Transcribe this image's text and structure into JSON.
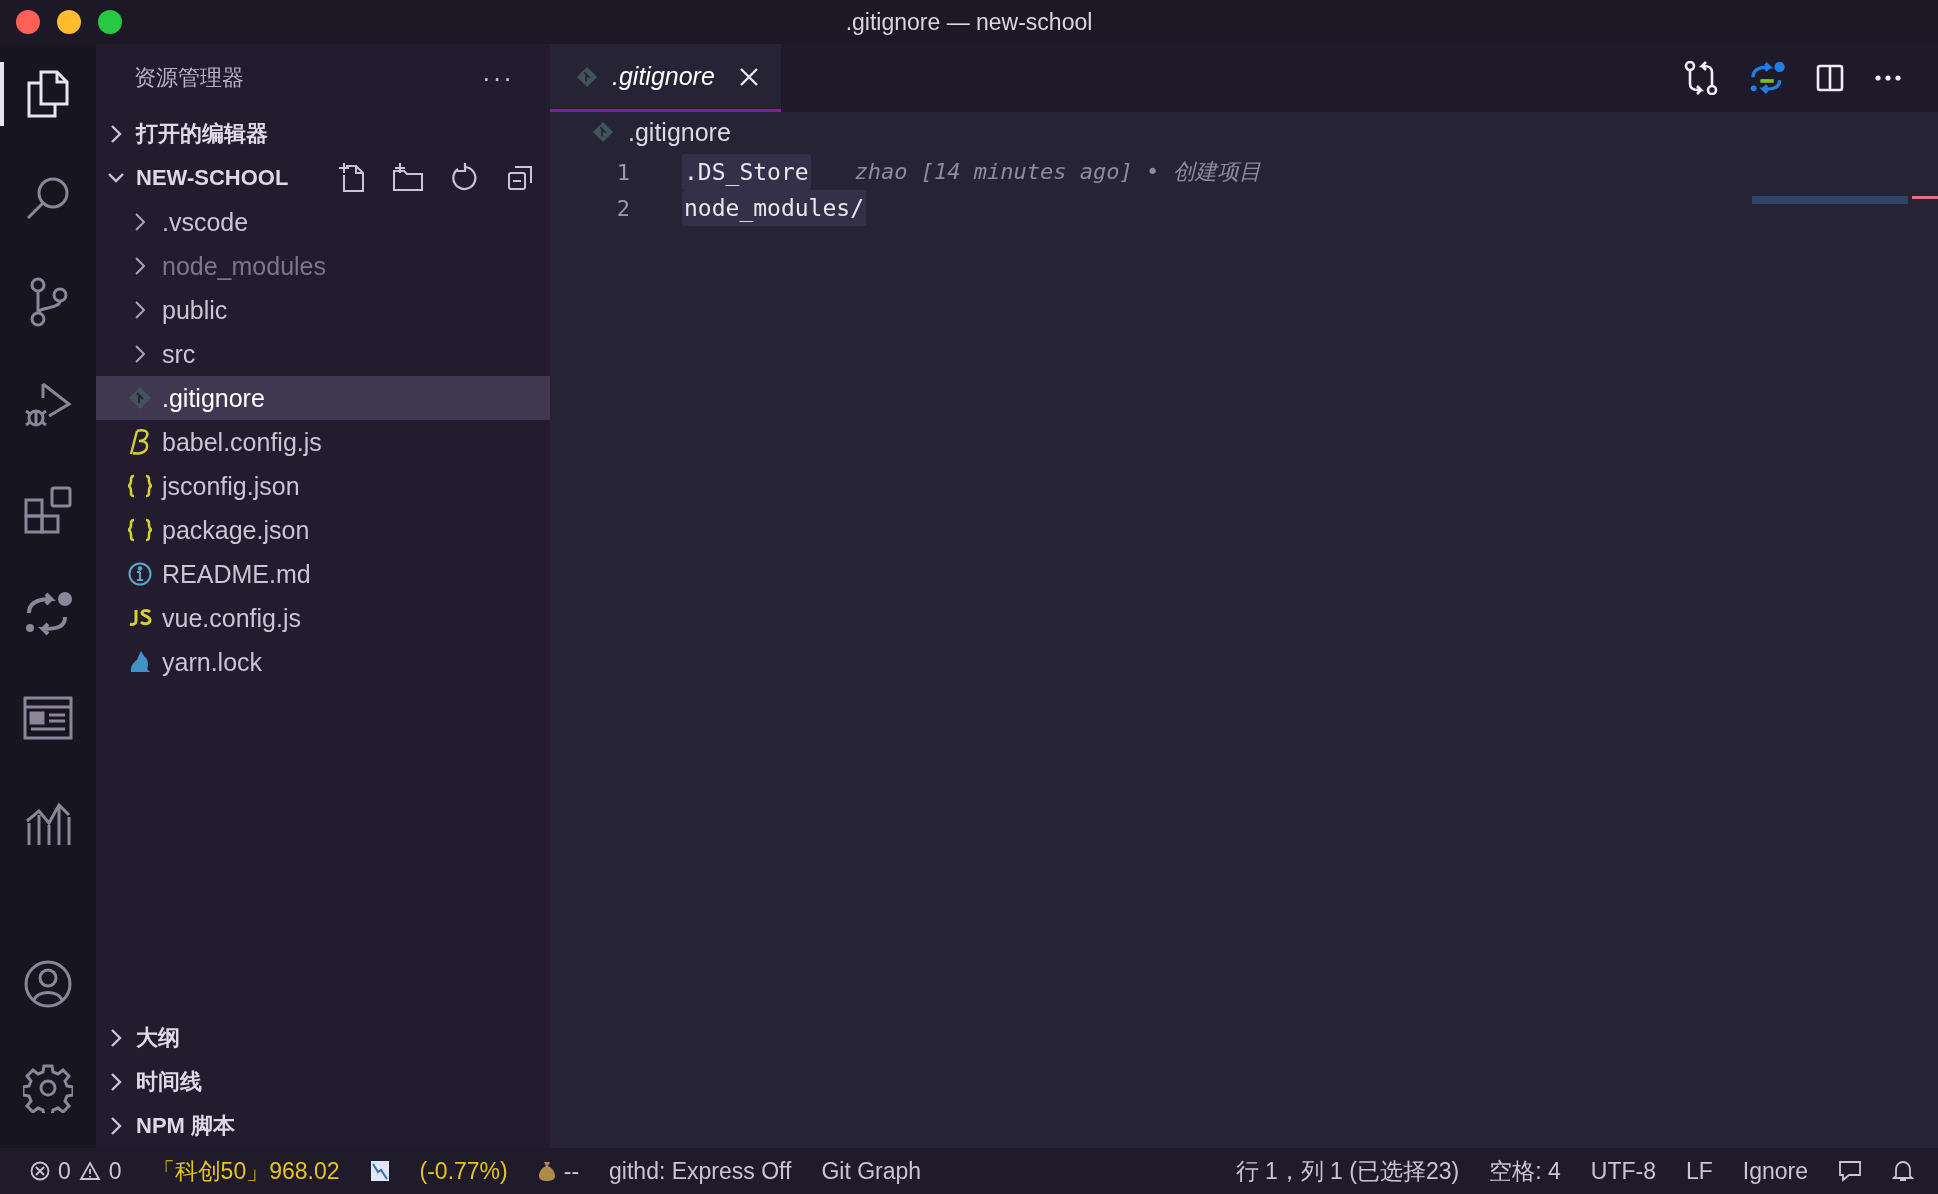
{
  "window": {
    "title": ".gitignore — new-school"
  },
  "activity_bar": {
    "items": [
      {
        "kind": "files",
        "selected": true
      },
      {
        "kind": "search",
        "selected": false
      },
      {
        "kind": "source-control",
        "selected": false
      },
      {
        "kind": "run",
        "selected": false
      },
      {
        "kind": "extensions",
        "selected": false
      },
      {
        "kind": "diff",
        "selected": false
      },
      {
        "kind": "panel",
        "selected": false
      },
      {
        "kind": "chart",
        "selected": false
      }
    ],
    "bottom": [
      {
        "kind": "account"
      },
      {
        "kind": "settings"
      }
    ]
  },
  "sidebar": {
    "title": "资源管理器",
    "more": "···",
    "sections": [
      {
        "label": "打开的编辑器",
        "expanded": false
      },
      {
        "label": "NEW-SCHOOL",
        "expanded": true,
        "children": [
          {
            "name": ".vscode",
            "kind": "folder",
            "expanded": false,
            "ignored": false,
            "selected": false
          },
          {
            "name": "node_modules",
            "kind": "folder",
            "expanded": false,
            "ignored": true,
            "selected": false
          },
          {
            "name": "public",
            "kind": "folder",
            "expanded": false,
            "ignored": false,
            "selected": false
          },
          {
            "name": "src",
            "kind": "folder",
            "expanded": false,
            "ignored": false,
            "selected": false
          },
          {
            "name": ".gitignore",
            "kind": "git",
            "ignored": false,
            "selected": true
          },
          {
            "name": "babel.config.js",
            "kind": "babel",
            "ignored": false,
            "selected": false
          },
          {
            "name": "jsconfig.json",
            "kind": "json",
            "ignored": false,
            "selected": false
          },
          {
            "name": "package.json",
            "kind": "json",
            "ignored": false,
            "selected": false
          },
          {
            "name": "README.md",
            "kind": "info",
            "ignored": false,
            "selected": false
          },
          {
            "name": "vue.config.js",
            "kind": "js",
            "ignored": false,
            "selected": false
          },
          {
            "name": "yarn.lock",
            "kind": "yarn",
            "ignored": false,
            "selected": false
          }
        ]
      }
    ],
    "bottom_sections": [
      {
        "label": "大纲",
        "expanded": false
      },
      {
        "label": "时间线",
        "expanded": false
      },
      {
        "label": "NPM 脚本",
        "expanded": false
      }
    ]
  },
  "editor": {
    "tabs": [
      {
        "label": ".gitignore",
        "selected": true
      }
    ],
    "breadcrumb": ".gitignore",
    "lines": [
      {
        "number": "1",
        "text": ".DS_Store",
        "selected": true,
        "blame": "zhao [14 minutes ago] • 创建项目"
      },
      {
        "number": "2",
        "text": "node_modules/",
        "selected": true
      }
    ]
  },
  "status_bar": {
    "errors": "0",
    "warnings": "0",
    "stock_quote": "「科创50」968.02",
    "stock_change": "(-0.77%)",
    "fund": "--",
    "items": [
      "githd: Express Off",
      "Git Graph"
    ],
    "right": [
      "行 1，列 1 (已选择23)",
      "空格: 4",
      "UTF-8",
      "LF",
      "Ignore"
    ]
  }
}
